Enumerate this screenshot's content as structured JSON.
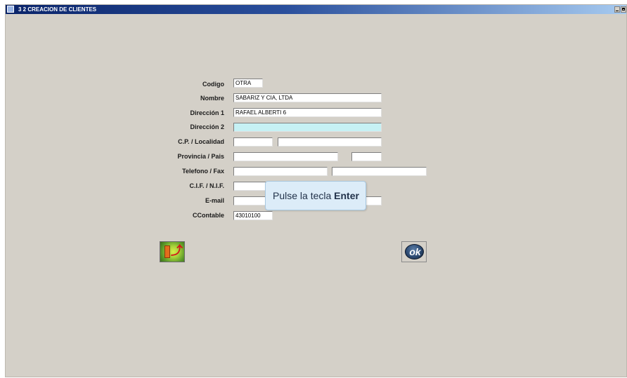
{
  "window": {
    "title": "3 2  CREACION DE CLIENTES"
  },
  "form": {
    "codigo": {
      "label": "Codigo",
      "value": "OTRA"
    },
    "nombre": {
      "label": "Nombre",
      "value": "SABARIZ Y CIA, LTDA"
    },
    "direccion1": {
      "label": "Dirección 1",
      "value": "RAFAEL ALBERTI 6"
    },
    "direccion2": {
      "label": "Dirección 2",
      "value": ""
    },
    "cp_localidad": {
      "label": "C.P. / Localidad",
      "cp": "",
      "localidad": ""
    },
    "provincia_pais": {
      "label": "Provincia / Pais",
      "provincia": "",
      "pais": ""
    },
    "telefono_fax": {
      "label": "Telefono / Fax",
      "telefono": "",
      "fax": ""
    },
    "cif_nif": {
      "label": "C.I.F. / N.I.F.",
      "value": ""
    },
    "email": {
      "label": "E-mail",
      "value": "",
      "extra": ""
    },
    "ccontable": {
      "label": "CContable",
      "value": "43010100"
    }
  },
  "tooltip": {
    "prefix": "Pulse la tecla ",
    "key": "Enter"
  },
  "buttons": {
    "exit_icon": "exit-door-running-man-icon",
    "ok_label": "ok"
  },
  "colors": {
    "active_field": "#c6f1f4",
    "window_bg": "#d4d0c8",
    "titlebar": "#0a246a"
  }
}
